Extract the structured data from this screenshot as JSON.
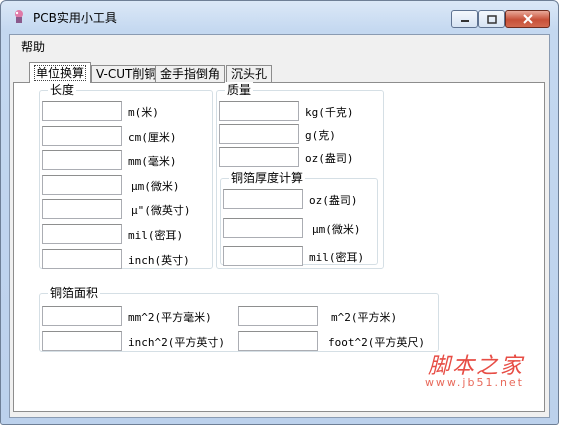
{
  "window": {
    "title": "PCB实用小工具"
  },
  "menu": {
    "help": "帮助"
  },
  "tabs": [
    "单位换算",
    "V-CUT削铜",
    "金手指倒角",
    "沉头孔"
  ],
  "length": {
    "title": "长度",
    "units": [
      "m(米)",
      "cm(厘米)",
      "mm(毫米)",
      "μm(微米)",
      "μ\"(微英寸)",
      "mil(密耳)",
      "inch(英寸)"
    ]
  },
  "mass": {
    "title": "质量",
    "units": [
      "kg(千克)",
      "g(克)",
      "oz(盎司)"
    ]
  },
  "copper_thickness": {
    "title": "铜箔厚度计算",
    "units": [
      "oz(盎司)",
      "μm(微米)",
      "mil(密耳)"
    ]
  },
  "copper_area": {
    "title": "铜箔面积",
    "units": [
      "mm^2(平方毫米)",
      "m^2(平方米)",
      "inch^2(平方英寸)",
      "foot^2(平方英尺)"
    ]
  },
  "watermark": {
    "line1": "脚本之家",
    "line2": "www.jb51.net"
  }
}
